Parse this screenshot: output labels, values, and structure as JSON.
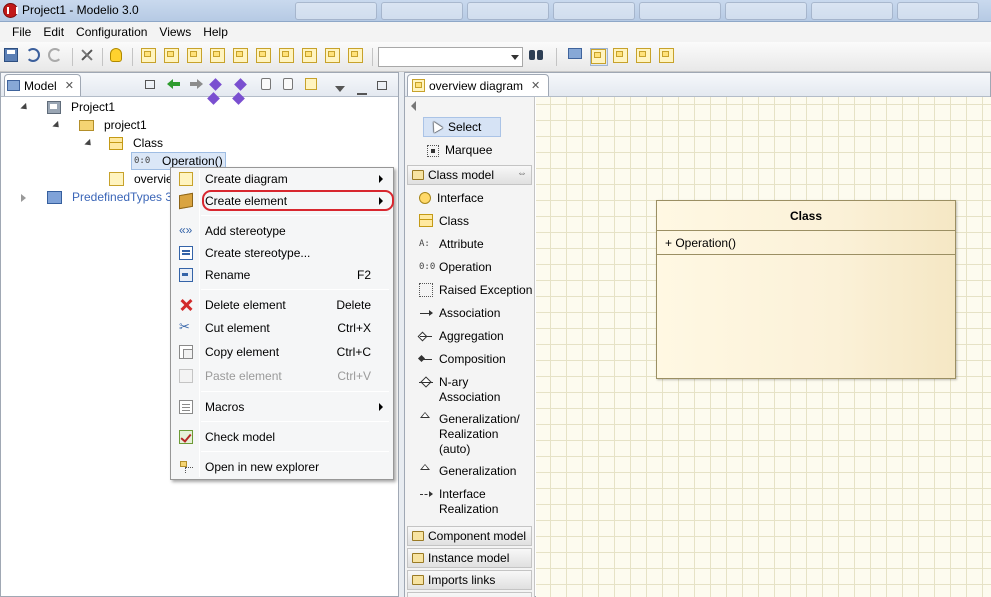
{
  "window": {
    "title": "Project1 - Modelio 3.0"
  },
  "menubar": {
    "items": [
      "File",
      "Edit",
      "Configuration",
      "Views",
      "Help"
    ]
  },
  "toolbar": {
    "combo_value": ""
  },
  "model_panel": {
    "tab_label": "Model",
    "tree": {
      "root": "Project1",
      "package": "project1",
      "class": "Class",
      "operation": "Operation()",
      "diagram": "overview diagram",
      "diagram_visible": "overvie",
      "predefined": "PredefinedTypes 3"
    }
  },
  "context_menu": {
    "items": [
      {
        "label": "Create diagram",
        "shortcut": "",
        "submenu": true,
        "enabled": true,
        "icon": "diagram-icon"
      },
      {
        "label": "Create element",
        "shortcut": "",
        "submenu": true,
        "enabled": true,
        "icon": "element-icon",
        "highlighted": true
      },
      {
        "label": "Add stereotype",
        "shortcut": "",
        "submenu": false,
        "enabled": true,
        "icon": "stereotype-icon"
      },
      {
        "label": "Create stereotype...",
        "shortcut": "",
        "submenu": false,
        "enabled": true,
        "icon": "create-stereotype-icon"
      },
      {
        "label": "Rename",
        "shortcut": "F2",
        "submenu": false,
        "enabled": true,
        "icon": "rename-icon"
      },
      {
        "label": "Delete element",
        "shortcut": "Delete",
        "submenu": false,
        "enabled": true,
        "icon": "delete-icon"
      },
      {
        "label": "Cut element",
        "shortcut": "Ctrl+X",
        "submenu": false,
        "enabled": true,
        "icon": "cut-icon"
      },
      {
        "label": "Copy element",
        "shortcut": "Ctrl+C",
        "submenu": false,
        "enabled": true,
        "icon": "copy-icon"
      },
      {
        "label": "Paste element",
        "shortcut": "Ctrl+V",
        "submenu": false,
        "enabled": false,
        "icon": "paste-icon"
      },
      {
        "label": "Macros",
        "shortcut": "",
        "submenu": true,
        "enabled": true,
        "icon": "macros-icon"
      },
      {
        "label": "Check model",
        "shortcut": "",
        "submenu": false,
        "enabled": true,
        "icon": "check-model-icon"
      },
      {
        "label": "Open in new explorer",
        "shortcut": "",
        "submenu": false,
        "enabled": true,
        "icon": "explorer-icon"
      }
    ],
    "highlight_color": "#d8272f"
  },
  "editor": {
    "tab_label": "overview diagram",
    "palette": {
      "select": "Select",
      "marquee": "Marquee",
      "drawers": {
        "class_model": "Class model",
        "component_model": "Component model",
        "instance_model": "Instance model",
        "imports_links": "Imports links"
      },
      "entries": [
        {
          "label": "Interface",
          "icon": "interface-icon"
        },
        {
          "label": "Class",
          "icon": "class-icon"
        },
        {
          "label": "Attribute",
          "icon": "attribute-icon",
          "glyph": "A:"
        },
        {
          "label": "Operation",
          "icon": "operation-icon",
          "glyph": "0:0"
        },
        {
          "label": "Raised Exception",
          "icon": "raised-exception-icon"
        },
        {
          "label": "Association",
          "icon": "association-icon"
        },
        {
          "label": "Aggregation",
          "icon": "aggregation-icon"
        },
        {
          "label": "Composition",
          "icon": "composition-icon"
        },
        {
          "label": "N-ary Association",
          "icon": "nary-association-icon"
        },
        {
          "label": "Generalization/ Realization (auto)",
          "icon": "generalization-realization-icon"
        },
        {
          "label": "Generalization",
          "icon": "generalization-icon"
        },
        {
          "label": "Interface Realization",
          "icon": "interface-realization-icon"
        }
      ]
    },
    "diagram": {
      "class_name": "Class",
      "operation": "+ Operation()"
    }
  },
  "colors": {
    "canvas_bg": "#fdfbef",
    "grid_line": "#e6e2c6",
    "class_fill": "#fbf1d8",
    "selection_bg": "#dbe7f7"
  }
}
